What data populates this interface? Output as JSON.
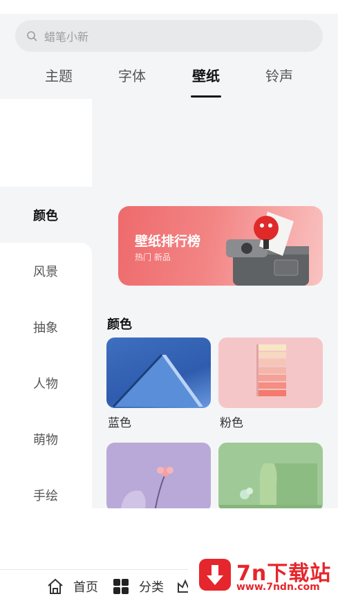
{
  "search": {
    "placeholder": "蜡笔小新"
  },
  "tabs": [
    {
      "label": "主题"
    },
    {
      "label": "字体"
    },
    {
      "label": "壁纸"
    },
    {
      "label": "铃声"
    }
  ],
  "active_tab": "壁纸",
  "sidebar": {
    "items": [
      {
        "label": "颜色"
      },
      {
        "label": "风景"
      },
      {
        "label": "抽象"
      },
      {
        "label": "人物"
      },
      {
        "label": "萌物"
      },
      {
        "label": "手绘"
      }
    ],
    "active": "颜色"
  },
  "banner": {
    "title": "壁纸排行榜",
    "subtitle": "热门 新品"
  },
  "section": {
    "title": "颜色",
    "cards": [
      {
        "label": "蓝色"
      },
      {
        "label": "粉色"
      },
      {
        "label": ""
      },
      {
        "label": ""
      }
    ]
  },
  "bottom_nav": {
    "items": [
      {
        "label": "首页",
        "icon": "home-icon"
      },
      {
        "label": "分类",
        "icon": "grid-icon"
      }
    ]
  },
  "watermark": {
    "title": "7n下载站",
    "url": "www.7ndn.com"
  },
  "colors": {
    "accent": "#111111",
    "banner": "#ee6a6c",
    "watermark": "#e5262c"
  }
}
